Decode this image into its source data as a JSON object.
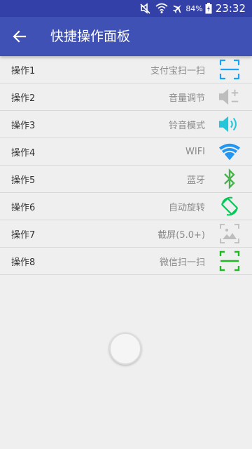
{
  "status_bar": {
    "battery_percent": "84%",
    "time": "23:32",
    "icons": [
      "mute-vibrate-icon",
      "wifi-icon",
      "airplane-icon",
      "battery-charging-icon"
    ]
  },
  "app_bar": {
    "title": "快捷操作面板",
    "back_icon": "arrow-left-icon"
  },
  "colors": {
    "app_bar": "#3f51b5",
    "status_bar": "#3340a8",
    "alipay_scan": "#1da1f2",
    "volume": "#bdbdbd",
    "ringtone": "#26c6da",
    "wifi": "#2196f3",
    "bluetooth": "#4caf50",
    "rotate": "#00c853",
    "screenshot": "#bdbdbd",
    "wechat_scan": "#1fb922"
  },
  "operations": [
    {
      "name": "操作1",
      "desc": "支付宝扫一扫",
      "icon": "scan-icon"
    },
    {
      "name": "操作2",
      "desc": "音量调节",
      "icon": "volume-adjust-icon"
    },
    {
      "name": "操作3",
      "desc": "铃音模式",
      "icon": "speaker-icon"
    },
    {
      "name": "操作4",
      "desc": "WIFI",
      "icon": "wifi-icon"
    },
    {
      "name": "操作5",
      "desc": "蓝牙",
      "icon": "bluetooth-icon"
    },
    {
      "name": "操作6",
      "desc": "自动旋转",
      "icon": "screen-rotate-icon"
    },
    {
      "name": "操作7",
      "desc": "截屏(5.0+)",
      "icon": "screenshot-icon"
    },
    {
      "name": "操作8",
      "desc": "微信扫一扫",
      "icon": "scan-icon"
    }
  ]
}
